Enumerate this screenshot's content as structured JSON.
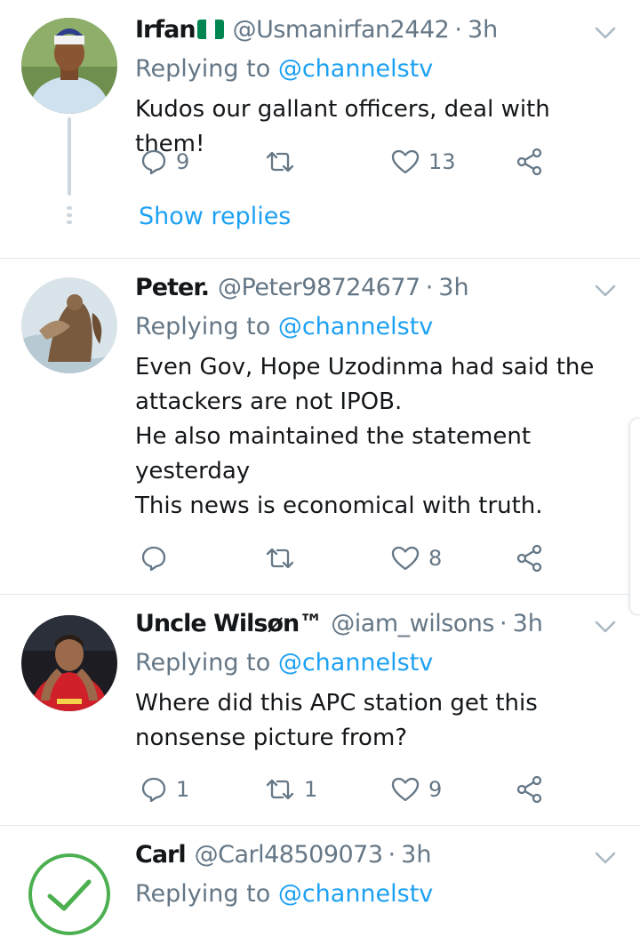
{
  "tweets": [
    {
      "name": "Irfan",
      "handle": "@Usmanirfan2442",
      "time": "3h",
      "replying_prefix": "Replying to",
      "replying_to": "@channelstv",
      "body": "Kudos our gallant officers, deal with them!",
      "replies": "9",
      "retweets": "",
      "likes": "13",
      "show_replies": "Show replies",
      "flag": "nigeria-flag"
    },
    {
      "name": "Peter.",
      "handle": "@Peter98724677",
      "time": "3h",
      "replying_prefix": "Replying to",
      "replying_to": "@channelstv",
      "body": "Even Gov, Hope Uzodinma had said the attackers are not IPOB.\nHe also maintained the statement yesterday\nThis news is economical with truth.",
      "replies": "",
      "retweets": "",
      "likes": "8"
    },
    {
      "name": "Uncle Wilsøn™",
      "handle": "@iam_wilsons",
      "time": "3h",
      "replying_prefix": "Replying to",
      "replying_to": "@channelstv",
      "body": "Where did this APC station get this nonsense picture from?",
      "replies": "1",
      "retweets": "1",
      "likes": "9"
    },
    {
      "name": "Carl",
      "handle": "@Carl48509073",
      "time": "3h",
      "replying_prefix": "Replying to",
      "replying_to": "@channelstv"
    }
  ],
  "colors": {
    "accent": "#1da1f2",
    "muted": "#657786",
    "text": "#14171a",
    "divider": "#e1e8ed",
    "flag_green": "#008751",
    "check_green": "#4caf50"
  },
  "icons": [
    "reply-icon",
    "retweet-icon",
    "like-icon",
    "share-icon",
    "chevron-down-icon",
    "checkmark-icon"
  ]
}
